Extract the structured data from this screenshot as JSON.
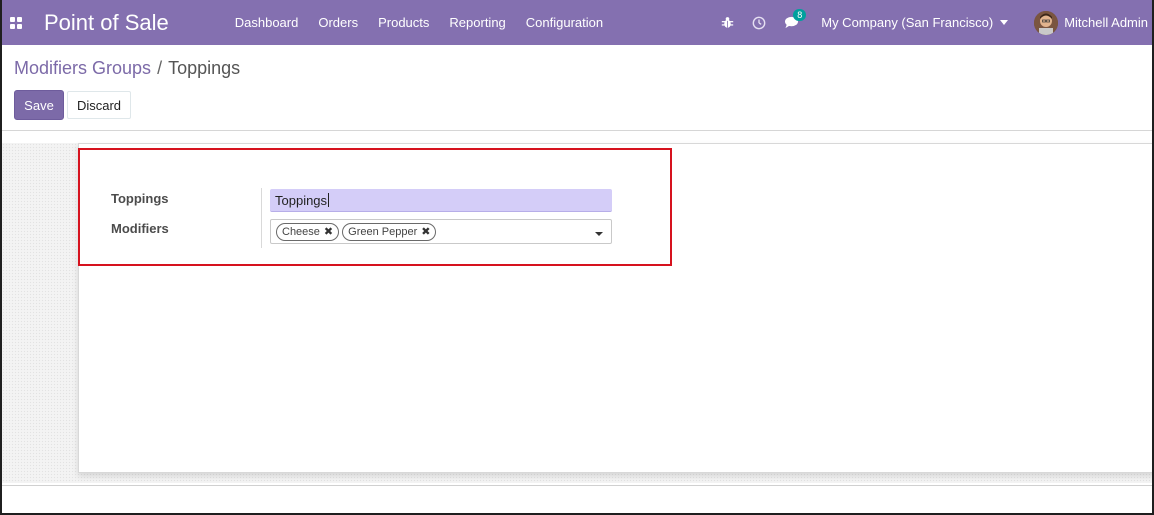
{
  "navbar": {
    "app_title": "Point of Sale",
    "menu": [
      "Dashboard",
      "Orders",
      "Products",
      "Reporting",
      "Configuration"
    ],
    "messages_badge": "8",
    "company": "My Company (San Francisco)",
    "user_name": "Mitchell Admin",
    "icons": [
      "apps-grid-icon",
      "bug-icon",
      "clock-icon",
      "chat-icon",
      "caret-down-icon"
    ],
    "accent_color": "#8470b0"
  },
  "breadcrumb": {
    "parent": "Modifiers Groups",
    "separator": "/",
    "current": "Toppings"
  },
  "buttons": {
    "save": "Save",
    "discard": "Discard"
  },
  "form": {
    "name_label": "Toppings",
    "name_value": "Toppings",
    "modifiers_label": "Modifiers",
    "modifiers": [
      "Cheese",
      "Green Pepper"
    ],
    "tag_remove_glyph": "✖",
    "highlight_color": "#d6121e"
  }
}
